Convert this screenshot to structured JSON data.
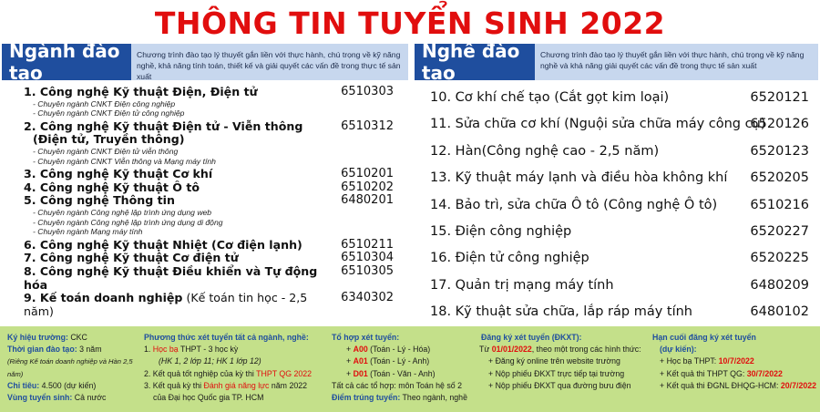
{
  "title": "THÔNG TIN TUYỂN SINH 2022",
  "left_section": {
    "label": "Ngành đào tạo",
    "description": "Chương trình đào tạo lý thuyết gắn liền với thực hành, chú trọng về kỹ năng nghề, khả năng tính toán, thiết kế và giải quyết các vấn đề trong thực tế sản xuất",
    "programs": [
      {
        "name": "1. Công nghệ Kỹ thuật Điện, Điện tử",
        "code": "6510303",
        "subs": [
          "- Chuyên ngành CNKT Điện công nghiệp",
          "- Chuyên ngành CNKT Điện tử công nghiệp"
        ]
      },
      {
        "name": "2. Công nghệ Kỹ thuật Điện tử - Viễn thông",
        "name2": "(Điện tử, Truyền thông)",
        "code": "6510312",
        "subs": [
          "- Chuyên ngành CNKT Điện tử viễn thông",
          "- Chuyên ngành CNKT Viễn thông và Mạng máy tính"
        ]
      },
      {
        "name": "3. Công nghệ Kỹ thuật Cơ khí",
        "code": "6510201"
      },
      {
        "name": "4. Công nghệ Kỹ thuật Ô tô",
        "code": "6510202"
      },
      {
        "name": "5. Công nghệ Thông tin",
        "code": "6480201",
        "subs": [
          "- Chuyên ngành Công nghệ lập trình ứng dụng web",
          "- Chuyên ngành Công nghệ lập trình ứng dụng di động",
          "- Chuyên ngành Mạng máy tính"
        ]
      },
      {
        "name": "6. Công nghệ Kỹ thuật Nhiệt (Cơ điện lạnh)",
        "code": "6510211"
      },
      {
        "name": "7. Công nghệ Kỹ thuật Cơ điện tử",
        "code": "6510304"
      },
      {
        "name": "8. Công nghệ Kỹ thuật Điều khiển và Tự động hóa",
        "code": "6510305"
      },
      {
        "name": "9. Kế toán doanh nghiệp",
        "note": " (Kế toán tin học - 2,5 năm)",
        "code": "6340302"
      }
    ]
  },
  "right_section": {
    "label": "Nghề đào tạo",
    "description": "Chương trình đào tạo lý thuyết gắn liền với thực hành, chú trọng về kỹ năng nghề và khả năng giải quyết các vấn đề trong thực tế sản xuất",
    "programs": [
      {
        "name": "10. Cơ khí chế tạo (Cắt gọt kim loại)",
        "code": "6520121"
      },
      {
        "name": "11. Sửa chữa cơ khí (Nguội sửa chữa máy công cụ)",
        "code": "6520126"
      },
      {
        "name": "12. Hàn(Công nghệ cao - 2,5 năm)",
        "code": "6520123"
      },
      {
        "name": "13. Kỹ thuật máy lạnh và điều hòa không khí",
        "code": "6520205"
      },
      {
        "name": "14. Bảo trì, sửa chữa Ô tô (Công nghệ Ô tô)",
        "code": "6510216"
      },
      {
        "name": "15. Điện công nghiệp",
        "code": "6520227"
      },
      {
        "name": "16. Điện tử công nghiệp",
        "code": "6520225"
      },
      {
        "name": "17. Quản trị mạng máy tính",
        "code": "6480209"
      },
      {
        "name": "18. Kỹ thuật sửa chữa, lắp ráp máy tính",
        "code": "6480102"
      }
    ]
  },
  "bottom": {
    "col1": {
      "school_code_label": "Ký hiệu trường:",
      "school_code": " CKC",
      "duration_label": "Thời gian đào tạo:",
      "duration": " 3 năm",
      "duration_note": "(Riêng Kế toán doanh nghiệp và Hàn 2,5 năm)",
      "quota_label": "Chỉ tiêu:",
      "quota": " 4.500 (dự kiến)",
      "region_label": "Vùng tuyển sinh:",
      "region": " Cả nước"
    },
    "col2": {
      "head": "Phương thức xét tuyển tất cả ngành, nghề:",
      "l1_num": "1. ",
      "l1_red": "Học bạ",
      "l1_rest": " THPT - 3 học kỳ",
      "l2": "(HK 1, 2 lớp 11; HK 1 lớp 12)",
      "l3_a": "2. Kết quả tốt nghiệp của kỳ thi ",
      "l3_red": "THPT QG 2022",
      "l4_a": "3. Kết quả kỳ thi ",
      "l4_red": "Đánh giá năng lực",
      "l4_b": " năm 2022",
      "l5": "của Đại học Quốc gia TP. HCM"
    },
    "col3": {
      "head": "Tổ hợp xét tuyển:",
      "a00_code": "A00",
      "a00": " (Toán - Lý - Hóa)",
      "a01_code": "A01",
      "a01": " (Toán - Lý - Anh)",
      "d01_code": "D01",
      "d01": " (Toán - Văn - Anh)",
      "note": "Tất cả các tổ hợp: môn Toán hệ số 2",
      "score_label": "Điểm trúng tuyển:",
      "score": " Theo ngành, nghề"
    },
    "col4": {
      "head": "Đăng ký xét tuyển (ĐKXT):",
      "l1_a": "Từ ",
      "l1_red": "01/01/2022",
      "l1_b": ", theo một trong các hình thức:",
      "l2": "+ Đăng ký online trên website trường",
      "l3": "+ Nộp phiếu ĐKXT trực tiếp tại trường",
      "l4": "+ Nộp phiếu ĐKXT qua đường bưu điện"
    },
    "col5": {
      "head": "Hạn cuối đăng ký xét tuyển",
      "head2": "(dự kiến):",
      "l1_a": "+ Học bạ THPT: ",
      "l1_red": "10/7/2022",
      "l2_a": "+ Kết quả thi THPT QG: ",
      "l2_red": "30/7/2022",
      "l3_a": "+ Kết quả thi ĐGNL ĐHQG-HCM: ",
      "l3_red": "20/7/2022"
    }
  }
}
